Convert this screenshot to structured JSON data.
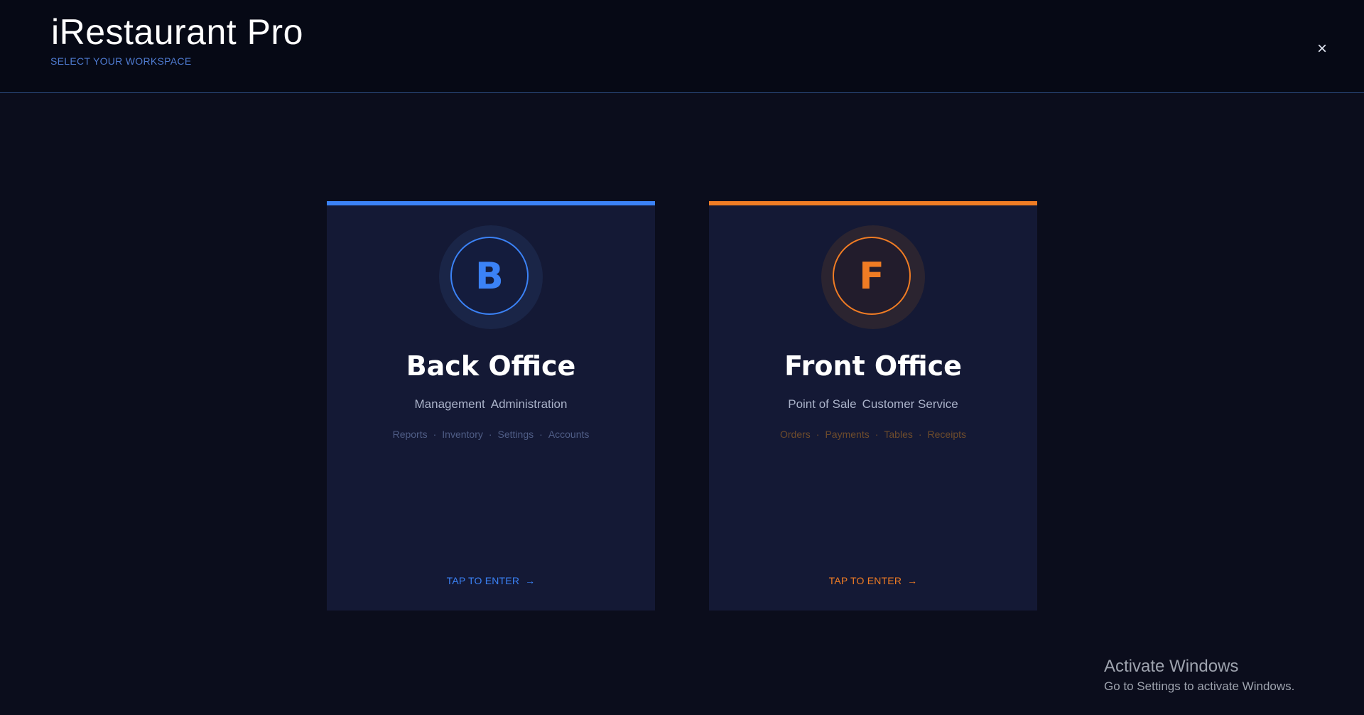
{
  "app": {
    "title": "iRestaurant Pro",
    "subtitle": "SELECT YOUR WORKSPACE",
    "close_label": "×"
  },
  "cards": [
    {
      "id": "back-office",
      "letter": "B",
      "title": "Back Office",
      "subtitle_parts": [
        "Management",
        "Administration"
      ],
      "features": [
        "Reports",
        "Inventory",
        "Settings",
        "Accounts"
      ],
      "separator": "·",
      "enter_label": "TAP TO ENTER",
      "enter_arrow": "→",
      "accent_color": "#3b82f6"
    },
    {
      "id": "front-office",
      "letter": "F",
      "title": "Front Office",
      "subtitle_parts": [
        "Point of Sale",
        "Customer Service"
      ],
      "features": [
        "Orders",
        "Payments",
        "Tables",
        "Receipts"
      ],
      "separator": "·",
      "enter_label": "TAP TO ENTER",
      "enter_arrow": "→",
      "accent_color": "#f07c24"
    }
  ],
  "watermark": {
    "title": "Activate Windows",
    "body": "Go to Settings to activate Windows."
  },
  "colors": {
    "background": "#0b0d1c",
    "header_background": "#060915",
    "card_background": "#141935"
  }
}
